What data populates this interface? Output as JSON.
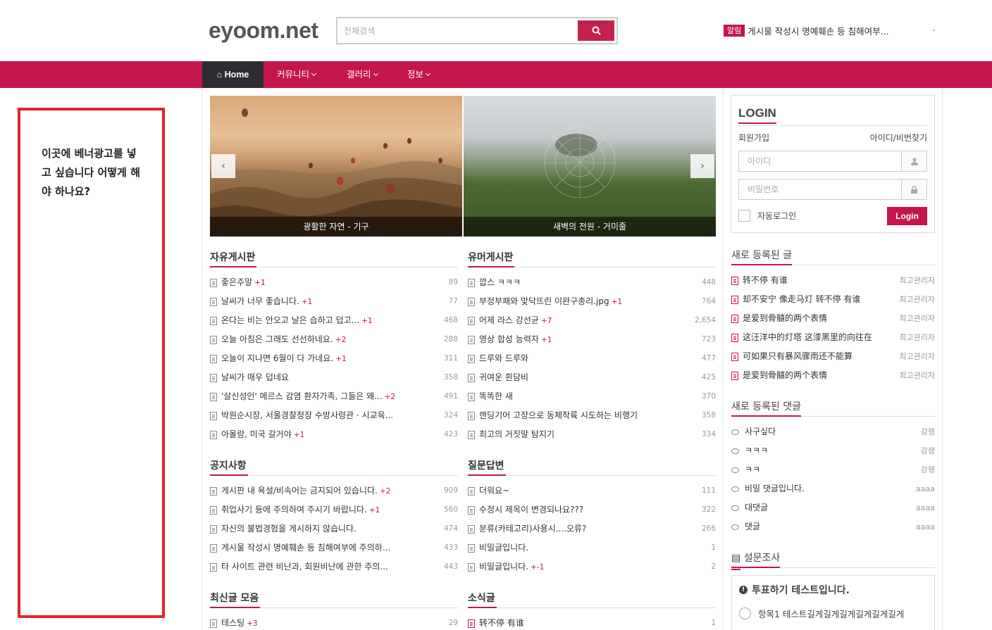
{
  "header": {
    "logo": "eyoom.net",
    "search_placeholder": "전체검색",
    "notice_badge": "알림",
    "notice_text": "게시물 작성시 명예훼손 등 침해여부...",
    "notice_dot": "-"
  },
  "nav": {
    "home": "Home",
    "items": [
      "커뮤니티",
      "갤러리",
      "정보"
    ]
  },
  "banner": {
    "text": "이곳에 베너광고를 넣고 싶습니다 어떻게 해야 하나요?"
  },
  "slider": {
    "captions": [
      "광활한 자연 - 기구",
      "새벽의 전원 - 거미줄"
    ]
  },
  "boards": {
    "free": {
      "title": "자유게시판",
      "items": [
        {
          "title": "좋은주말",
          "count": "+1",
          "views": "89"
        },
        {
          "title": "날씨가 너무 좋습니다.",
          "count": "+1",
          "views": "77"
        },
        {
          "title": "온다는 비는 안오고 날은 습하고 덥고...",
          "count": "+1",
          "views": "468"
        },
        {
          "title": "오늘 아침은 그래도 선선하네요.",
          "count": "+2",
          "views": "288"
        },
        {
          "title": "오늘이 지나면 6월이 다 가네요.",
          "count": "+1",
          "views": "311"
        },
        {
          "title": "날씨가 매우 덥네요",
          "count": "",
          "views": "358"
        },
        {
          "title": "'살신성인' 메르스 감염 환자가족, 그들은 왜...",
          "count": "+2",
          "views": "491"
        },
        {
          "title": "박원순시장, 서울경찰청장 수방사령관 · 시교육...",
          "count": "",
          "views": "324"
        },
        {
          "title": "아몰랑, 미국 갈거야",
          "count": "+1",
          "views": "423"
        }
      ]
    },
    "humor": {
      "title": "유머게시판",
      "items": [
        {
          "title": "깝스 ㅋㅋㅋ",
          "count": "",
          "views": "448"
        },
        {
          "title": "부정부패와 맞닥뜨린 이완구총리.jpg",
          "count": "+1",
          "views": "764"
        },
        {
          "title": "어제 라스 강선균",
          "count": "+7",
          "views": "2,654"
        },
        {
          "title": "영상 합성 능력자",
          "count": "+1",
          "views": "723"
        },
        {
          "title": "드루와 드루와",
          "count": "",
          "views": "477"
        },
        {
          "title": "귀여운 흰담비",
          "count": "",
          "views": "425"
        },
        {
          "title": "똑똑한 새",
          "count": "",
          "views": "370"
        },
        {
          "title": "랜딩기어 고장으로 동체착륙 시도하는 비행기",
          "count": "",
          "views": "358"
        },
        {
          "title": "최고의 거짓말 탐지기",
          "count": "",
          "views": "334"
        }
      ]
    },
    "notice": {
      "title": "공지사항",
      "items": [
        {
          "title": "게시판 내 욕설/비속어는 금지되어 있습니다.",
          "count": "+2",
          "views": "909"
        },
        {
          "title": "취업사기 등에 주의하여 주시기 바랍니다.",
          "count": "+1",
          "views": "560"
        },
        {
          "title": "자신의 불법경험을 게시하지 않습니다.",
          "count": "",
          "views": "474"
        },
        {
          "title": "게시물 작성시 명예훼손 등 침해여부에 주의하...",
          "count": "",
          "views": "433"
        },
        {
          "title": "타 사이트 관련 비난과, 회원비난에 관한 주의...",
          "count": "",
          "views": "443"
        }
      ]
    },
    "qna": {
      "title": "질문답변",
      "items": [
        {
          "title": "더워요~",
          "count": "",
          "views": "111"
        },
        {
          "title": "수정시 제목이 변경되나요???",
          "count": "",
          "views": "322"
        },
        {
          "title": "분류(카테고리)사용시....오류?",
          "count": "",
          "views": "266"
        },
        {
          "title": "비밀글입니다.",
          "count": "",
          "views": "1"
        },
        {
          "title": "비밀글입니다.",
          "count": "+-1",
          "views": "2"
        }
      ]
    },
    "latest": {
      "title": "최신글 모음",
      "items": [
        {
          "title": "테스팅",
          "count": "+3",
          "views": "29"
        }
      ]
    },
    "news": {
      "title": "소식글",
      "items": [
        {
          "title": "转不停 有谁",
          "count": "",
          "views": "1"
        }
      ]
    }
  },
  "login": {
    "title": "LOGIN",
    "join": "회원가입",
    "find": "아이디/비번찾기",
    "id_placeholder": "아이디",
    "pw_placeholder": "비밀번호",
    "auto": "자동로그인",
    "button": "Login"
  },
  "new_posts": {
    "title": "새로 등록된 글",
    "items": [
      {
        "title": "转不停 有谁",
        "author": "최고관리자"
      },
      {
        "title": "却不安宁 像走马灯 转不停 有谁",
        "author": "최고관리자"
      },
      {
        "title": "是爱到骨髓的两个表情",
        "author": "최고관리자"
      },
      {
        "title": "这汪洋中的灯塔 这漆黑里的向往在",
        "author": "최고관리자"
      },
      {
        "title": "可如果只有暴风骤雨还不能算",
        "author": "최고관리자"
      },
      {
        "title": "是爱到骨髓的两个表情",
        "author": "최고관리자"
      }
    ]
  },
  "new_comments": {
    "title": "새로 등록된 댓글",
    "items": [
      {
        "title": "사구싶다",
        "author": "강쟁"
      },
      {
        "title": "ㅋㅋㅋ",
        "author": "강쟁"
      },
      {
        "title": "ㅋㅋ",
        "author": "강쟁"
      },
      {
        "title": "비밀 댓글입니다.",
        "author": "aaaa"
      },
      {
        "title": "대댓글",
        "author": "aaaa"
      },
      {
        "title": "댓글",
        "author": "aaaa"
      }
    ]
  },
  "survey": {
    "title": "설문조사",
    "question": "투표하기 테스트입니다.",
    "option1": "항목1 테스트길게길게길게길게길게길게"
  },
  "colors": {
    "accent": "#c4154d",
    "home_bg": "#2d2d32",
    "banner_border": "#e1252c"
  }
}
